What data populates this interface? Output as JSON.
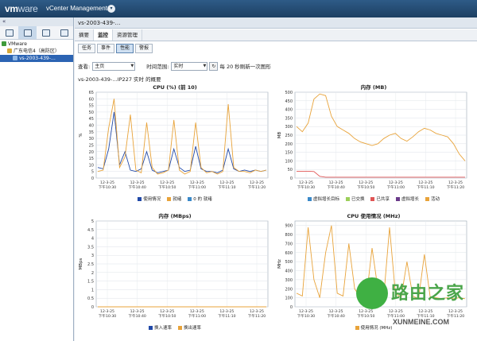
{
  "app": {
    "logo_vm": "vm",
    "logo_ware": "ware",
    "product": "vCenter Management"
  },
  "left": {
    "collapse": "«",
    "tree": [
      {
        "label": "VMware",
        "level": 0,
        "color": "#3f9b3a"
      },
      {
        "label": "广东电信4（高防区）",
        "level": 1,
        "color": "#d6a93a"
      },
      {
        "label": "vs-2003-439-…",
        "level": 2,
        "color": "#4f7fb8",
        "selected": true
      }
    ]
  },
  "main": {
    "vm_title": "vs-2003-439-…",
    "tabs": [
      "摘要",
      "监控",
      "资源管理"
    ],
    "active_tab": 1,
    "subtabs": [
      "任务",
      "事件",
      "性能",
      "警报"
    ],
    "active_subtab": 2,
    "view_label": "查看:",
    "view_value": "主页",
    "range_label": "时间范围:",
    "range_value": "实时",
    "refresh_text": "每 20 秒刷新一次图形",
    "caption": "vs-2003-439-…IP227 实时 的概要"
  },
  "chart_data": [
    {
      "type": "line",
      "title": "CPU (%) (前 10)",
      "ylabel": "%",
      "ylim": [
        0,
        65
      ],
      "yticks": [
        0,
        5,
        10,
        15,
        20,
        25,
        30,
        35,
        40,
        45,
        50,
        55,
        60,
        65
      ],
      "x": [
        "12-3-25 下午10:30",
        "12-3-25 下午10:40",
        "12-3-25 下午10:50",
        "12-3-25 下午11:00",
        "12-3-25 下午11:10",
        "12-3-25 下午11:20"
      ],
      "series": [
        {
          "name": "使用情况",
          "color": "#2149a8",
          "values": [
            8,
            7,
            22,
            50,
            10,
            20,
            6,
            5,
            7,
            20,
            6,
            4,
            5,
            6,
            22,
            8,
            5,
            6,
            24,
            7,
            5,
            5,
            4,
            6,
            22,
            7,
            5,
            6,
            5,
            6,
            5,
            6
          ]
        },
        {
          "name": "就绪",
          "color": "#e8a33a",
          "values": [
            5,
            6,
            38,
            60,
            8,
            16,
            48,
            6,
            4,
            42,
            8,
            3,
            4,
            6,
            44,
            6,
            3,
            5,
            42,
            8,
            4,
            5,
            3,
            5,
            56,
            8,
            5,
            5,
            4,
            6,
            5,
            6
          ]
        },
        {
          "name": "0 的 就绪",
          "color": "#3a89c9",
          "values": []
        }
      ]
    },
    {
      "type": "line",
      "title": "内存 (MB)",
      "ylabel": "MB",
      "ylim": [
        0,
        500
      ],
      "yticks": [
        0,
        50,
        100,
        150,
        200,
        250,
        300,
        350,
        400,
        450,
        500
      ],
      "x": [
        "12-3-25 下午10:30",
        "12-3-25 下午10:40",
        "12-3-25 下午10:50",
        "12-3-25 下午11:00",
        "12-3-25 下午11:10",
        "12-3-25 下午11:20"
      ],
      "series": [
        {
          "name": "虚拟增长目标",
          "color": "#3a89c9",
          "values": []
        },
        {
          "name": "已交换",
          "color": "#9ccf5a",
          "values": []
        },
        {
          "name": "已共享",
          "color": "#e05555",
          "values": [
            40,
            40,
            40,
            38,
            10,
            5,
            5,
            5,
            5,
            5,
            5,
            5,
            5,
            5,
            5,
            5,
            5,
            5,
            5,
            5,
            5,
            5,
            5,
            5,
            5,
            5,
            5,
            5,
            5,
            5
          ]
        },
        {
          "name": "虚拟增长",
          "color": "#6a3a8a",
          "values": []
        },
        {
          "name": "活动",
          "color": "#e8a33a",
          "values": [
            300,
            270,
            320,
            460,
            490,
            480,
            360,
            300,
            280,
            260,
            230,
            210,
            200,
            190,
            200,
            230,
            250,
            260,
            230,
            215,
            240,
            270,
            290,
            280,
            260,
            250,
            240,
            200,
            140,
            100
          ]
        }
      ]
    },
    {
      "type": "line",
      "title": "内存 (MBps)",
      "ylabel": "MBps",
      "ylim": [
        0,
        5
      ],
      "yticks": [
        0,
        0.5,
        1,
        1.5,
        2,
        2.5,
        3,
        3.5,
        4,
        4.5,
        5
      ],
      "x": [
        "12-3-25 下午10:30",
        "12-3-25 下午10:40",
        "12-3-25 下午10:50",
        "12-3-25 下午11:00",
        "12-3-25 下午11:10",
        "12-3-25 下午11:20"
      ],
      "series": [
        {
          "name": "换入速率",
          "color": "#2149a8",
          "values": [
            0,
            0,
            0,
            0,
            0,
            0,
            0,
            0,
            0,
            0,
            0,
            0
          ]
        },
        {
          "name": "换出速率",
          "color": "#e8a33a",
          "values": [
            0,
            0,
            0,
            0,
            0,
            0,
            0,
            0,
            0,
            0,
            0,
            0
          ]
        }
      ]
    },
    {
      "type": "line",
      "title": "CPU 使用情况 (MHz)",
      "ylabel": "MHz",
      "ylim": [
        0,
        950
      ],
      "yticks": [
        0,
        100,
        200,
        300,
        400,
        500,
        600,
        700,
        800,
        900
      ],
      "x": [
        "12-3-25 下午10:30",
        "12-3-25 下午10:40",
        "12-3-25 下午10:50",
        "12-3-25 下午11:00",
        "12-3-25 下午11:10",
        "12-3-25 下午11:20"
      ],
      "series": [
        {
          "name": "使用情况 (MHz)",
          "color": "#e8a33a",
          "values": [
            150,
            120,
            880,
            300,
            100,
            600,
            900,
            150,
            120,
            700,
            200,
            100,
            90,
            650,
            200,
            110,
            880,
            150,
            100,
            500,
            120,
            90,
            580,
            110,
            100,
            90,
            100,
            90,
            100,
            90
          ]
        }
      ]
    }
  ],
  "watermark": {
    "cn": "路由之家",
    "url": "XUNMEINE.COM"
  }
}
